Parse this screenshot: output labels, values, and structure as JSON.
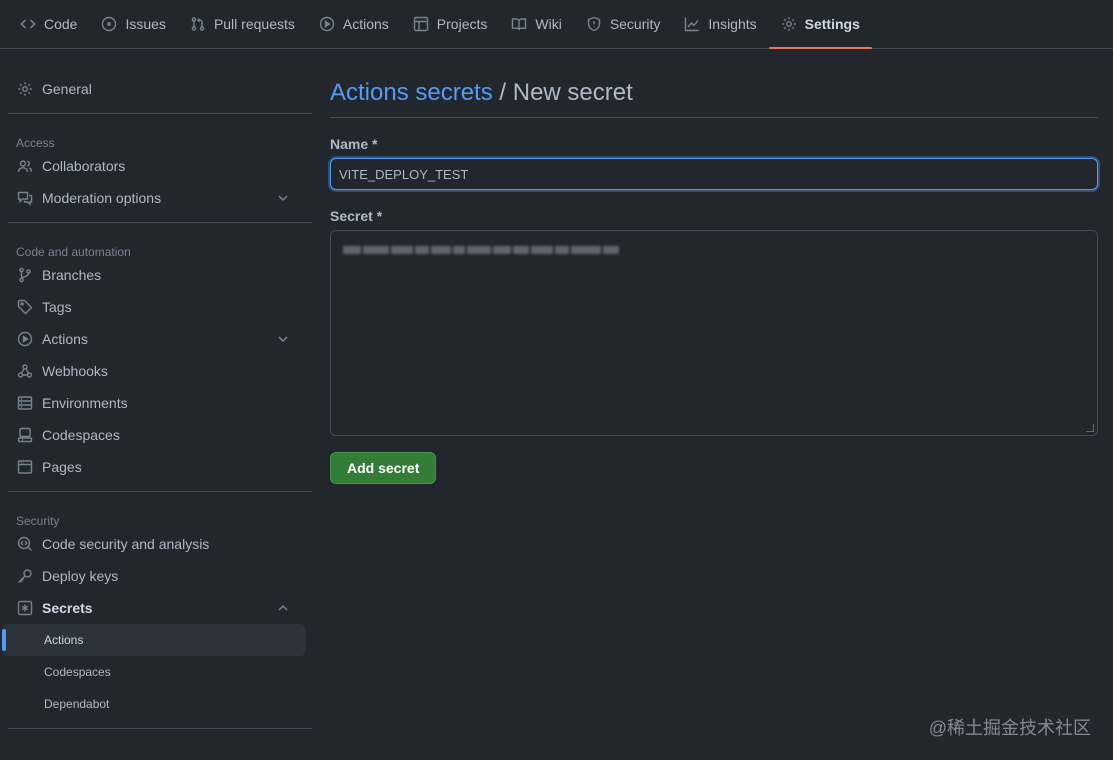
{
  "topnav": {
    "tabs": [
      {
        "label": "Code",
        "icon": "code-icon"
      },
      {
        "label": "Issues",
        "icon": "issue-icon"
      },
      {
        "label": "Pull requests",
        "icon": "pull-request-icon"
      },
      {
        "label": "Actions",
        "icon": "play-icon"
      },
      {
        "label": "Projects",
        "icon": "table-icon"
      },
      {
        "label": "Wiki",
        "icon": "book-icon"
      },
      {
        "label": "Security",
        "icon": "shield-icon"
      },
      {
        "label": "Insights",
        "icon": "graph-icon"
      },
      {
        "label": "Settings",
        "icon": "gear-icon",
        "selected": true
      }
    ]
  },
  "sidebar": {
    "general": "General",
    "access_heading": "Access",
    "collaborators": "Collaborators",
    "moderation": "Moderation options",
    "code_automation_heading": "Code and automation",
    "branches": "Branches",
    "tags": "Tags",
    "actions": "Actions",
    "webhooks": "Webhooks",
    "environments": "Environments",
    "codespaces": "Codespaces",
    "pages": "Pages",
    "security_heading": "Security",
    "code_security": "Code security and analysis",
    "deploy_keys": "Deploy keys",
    "secrets": "Secrets",
    "secrets_sub": [
      "Actions",
      "Codespaces",
      "Dependabot"
    ]
  },
  "main": {
    "breadcrumb_link": "Actions secrets",
    "breadcrumb_sep": " / ",
    "title": "New secret",
    "name_label": "Name *",
    "name_value": "VITE_DEPLOY_TEST",
    "secret_label": "Secret *",
    "add_button": "Add secret"
  },
  "watermark": "@稀土掘金技术社区",
  "colors": {
    "background": "#22272e",
    "accent_blue": "#539bf5",
    "selected_tab_underline": "#ec775c",
    "button_green": "#347d39"
  }
}
